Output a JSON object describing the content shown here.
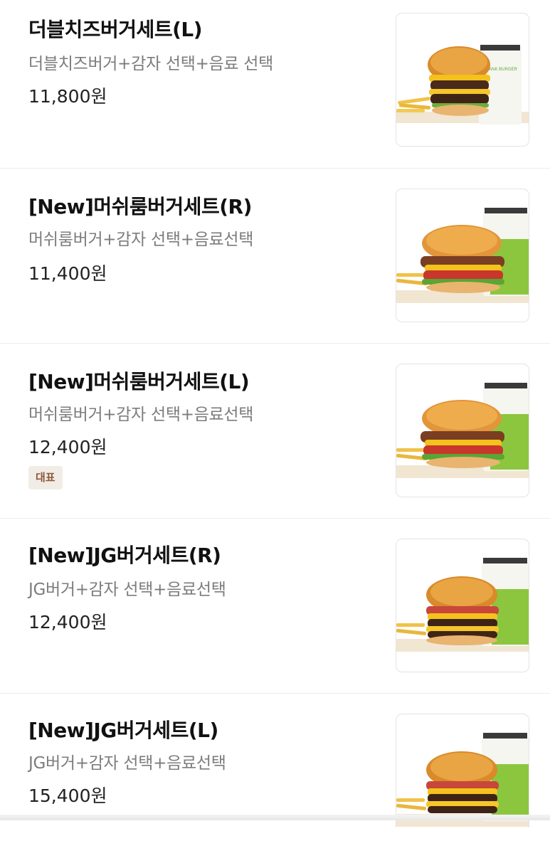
{
  "menu": {
    "items": [
      {
        "title": "더블치즈버거세트(L)",
        "description": "더블치즈버거+감자 선택+음료 선택",
        "price": "11,800원",
        "badge": "",
        "image_icon": "double-cheeseburger-set-photo"
      },
      {
        "title": "[New]머쉬룸버거세트(R)",
        "description": "머쉬룸버거+감자 선택+음료선택",
        "price": "11,400원",
        "badge": "",
        "image_icon": "mushroom-burger-set-photo"
      },
      {
        "title": "[New]머쉬룸버거세트(L)",
        "description": "머쉬룸버거+감자 선택+음료선택",
        "price": "12,400원",
        "badge": "대표",
        "image_icon": "mushroom-burger-set-photo"
      },
      {
        "title": "[New]JG버거세트(R)",
        "description": "JG버거+감자 선택+음료선택",
        "price": "12,400원",
        "badge": "",
        "image_icon": "jg-burger-set-photo"
      },
      {
        "title": "[New]JG버거세트(L)",
        "description": "JG버거+감자 선택+음료선택",
        "price": "15,400원",
        "badge": "",
        "image_icon": "jg-burger-set-photo"
      }
    ]
  },
  "photo_text": {
    "cup_brand": "FRANK BURGER"
  },
  "colors": {
    "badge_bg": "#f2ece6",
    "badge_text": "#8a5a3a",
    "description": "#7c7c7c",
    "cup_green": "#8cc63f"
  }
}
